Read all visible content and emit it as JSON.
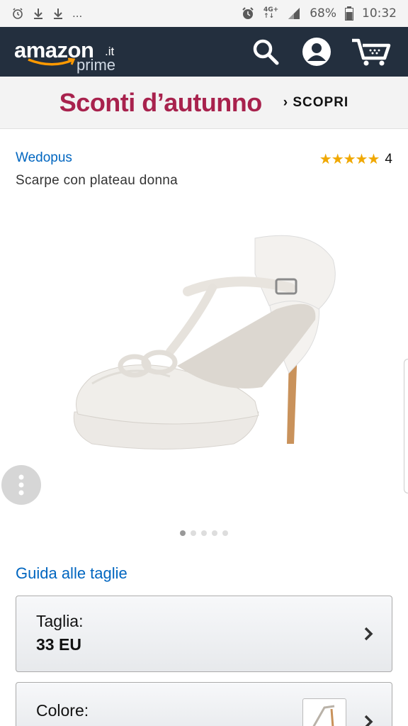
{
  "status_bar": {
    "battery": "68%",
    "time": "10:32",
    "network_top": "4G+",
    "network_bottom": "↑↓",
    "dots": "..."
  },
  "header": {
    "logo_word": "amazon",
    "logo_tld": ".it",
    "logo_sub": "prime"
  },
  "banner": {
    "title": "Sconti d’autunno",
    "cta": "› SCOPRI"
  },
  "product": {
    "brand": "Wedopus",
    "rating_stars": "★★★★★",
    "rating_count": "4",
    "title": "Scarpe con plateau donna",
    "image_count": 5,
    "active_image": 1
  },
  "size_guide": "Guida alle taglie",
  "size_selector": {
    "label": "Taglia:",
    "value": "33 EU"
  },
  "color_selector": {
    "label": "Colore:"
  },
  "colors": {
    "header_bg": "#232f3e",
    "banner_text": "#a8224d",
    "link": "#0066c0",
    "stars": "#f0a800"
  }
}
